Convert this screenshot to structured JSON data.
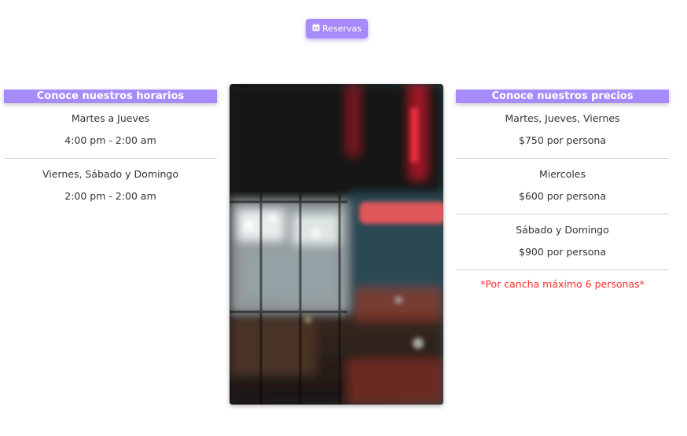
{
  "reserve_button": {
    "icon": "calendar-icon",
    "label": "Reservas",
    "color": "#a78bfa"
  },
  "schedule": {
    "title": "Conoce nuestros horarios",
    "blocks": [
      {
        "days": "Martes a Jueves",
        "hours": "4:00 pm - 2:00 am"
      },
      {
        "days": "Viernes, Sábado y Domingo",
        "hours": "2:00 pm - 2:00 am"
      }
    ]
  },
  "prices": {
    "title": "Conoce nuestros precios",
    "blocks": [
      {
        "days": "Martes, Jueves, Viernes",
        "price": "$750 por persona"
      },
      {
        "days": "Miercoles",
        "price": "$600 por persona"
      },
      {
        "days": "Sábado y Domingo",
        "price": "$900 por persona"
      }
    ],
    "note": "*Por cancha máximo 6 personas*",
    "note_color": "#ff2a2a"
  }
}
